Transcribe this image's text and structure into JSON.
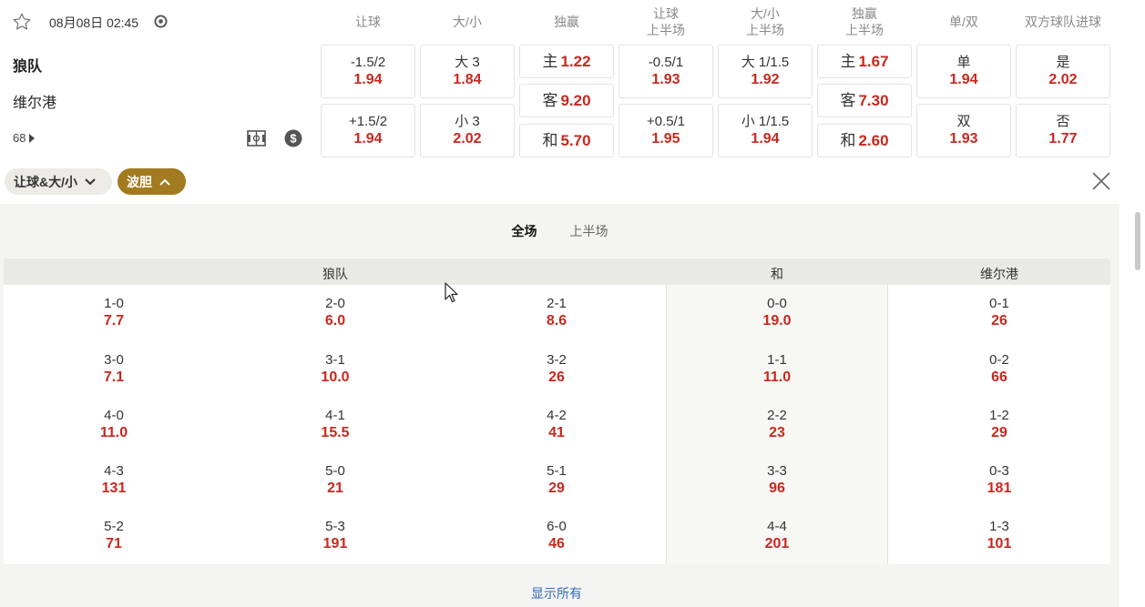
{
  "match": {
    "datetime": "08月08日 02:45",
    "home_team": "狼队",
    "away_team": "维尔港",
    "more_markets": "68"
  },
  "columns": [
    {
      "line1": "让球",
      "line2": ""
    },
    {
      "line1": "大/小",
      "line2": ""
    },
    {
      "line1": "独赢",
      "line2": ""
    },
    {
      "line1": "让球",
      "line2": "上半场"
    },
    {
      "line1": "大/小",
      "line2": "上半场"
    },
    {
      "line1": "独赢",
      "line2": "上半场"
    },
    {
      "line1": "单/双",
      "line2": ""
    },
    {
      "line1": "双方球队进球",
      "line2": ""
    }
  ],
  "odds": {
    "handicap": [
      {
        "label": "-1.5/2",
        "value": "1.94"
      },
      {
        "label": "+1.5/2",
        "value": "1.94"
      }
    ],
    "over_under": [
      {
        "label": "大 3",
        "value": "1.84"
      },
      {
        "label": "小 3",
        "value": "2.02"
      }
    ],
    "moneyline": [
      {
        "label": "主",
        "value": "1.22"
      },
      {
        "label": "客",
        "value": "9.20"
      },
      {
        "label": "和",
        "value": "5.70"
      }
    ],
    "handicap_1h": [
      {
        "label": "-0.5/1",
        "value": "1.93"
      },
      {
        "label": "+0.5/1",
        "value": "1.95"
      }
    ],
    "over_under_1h": [
      {
        "label": "大 1/1.5",
        "value": "1.92"
      },
      {
        "label": "小 1/1.5",
        "value": "1.94"
      }
    ],
    "moneyline_1h": [
      {
        "label": "主",
        "value": "1.67"
      },
      {
        "label": "客",
        "value": "7.30"
      },
      {
        "label": "和",
        "value": "2.60"
      }
    ],
    "odd_even": [
      {
        "label": "单",
        "value": "1.94"
      },
      {
        "label": "双",
        "value": "1.93"
      }
    ],
    "btts": [
      {
        "label": "是",
        "value": "2.02"
      },
      {
        "label": "否",
        "value": "1.77"
      }
    ]
  },
  "filters": {
    "market_group": "让球&大/小",
    "correct_score": "波胆"
  },
  "correct_score": {
    "tabs": [
      "全场",
      "上半场"
    ],
    "headers": {
      "home": "狼队",
      "draw": "和",
      "away": "维尔港"
    },
    "rows": [
      [
        {
          "s": "1-0",
          "p": "7.7"
        },
        {
          "s": "2-0",
          "p": "6.0"
        },
        {
          "s": "2-1",
          "p": "8.6"
        },
        {
          "s": "0-0",
          "p": "19.0"
        },
        {
          "s": "0-1",
          "p": "26"
        }
      ],
      [
        {
          "s": "3-0",
          "p": "7.1"
        },
        {
          "s": "3-1",
          "p": "10.0"
        },
        {
          "s": "3-2",
          "p": "26"
        },
        {
          "s": "1-1",
          "p": "11.0"
        },
        {
          "s": "0-2",
          "p": "66"
        }
      ],
      [
        {
          "s": "4-0",
          "p": "11.0"
        },
        {
          "s": "4-1",
          "p": "15.5"
        },
        {
          "s": "4-2",
          "p": "41"
        },
        {
          "s": "2-2",
          "p": "23"
        },
        {
          "s": "1-2",
          "p": "29"
        }
      ],
      [
        {
          "s": "4-3",
          "p": "131"
        },
        {
          "s": "5-0",
          "p": "21"
        },
        {
          "s": "5-1",
          "p": "29"
        },
        {
          "s": "3-3",
          "p": "96"
        },
        {
          "s": "0-3",
          "p": "181"
        }
      ],
      [
        {
          "s": "5-2",
          "p": "71"
        },
        {
          "s": "5-3",
          "p": "191"
        },
        {
          "s": "6-0",
          "p": "46"
        },
        {
          "s": "4-4",
          "p": "201"
        },
        {
          "s": "1-3",
          "p": "101"
        }
      ]
    ],
    "show_all": "显示所有"
  },
  "colors": {
    "odds_red": "#c8281e",
    "gold_chip": "#a27a1f",
    "link_blue": "#2f6db5"
  }
}
